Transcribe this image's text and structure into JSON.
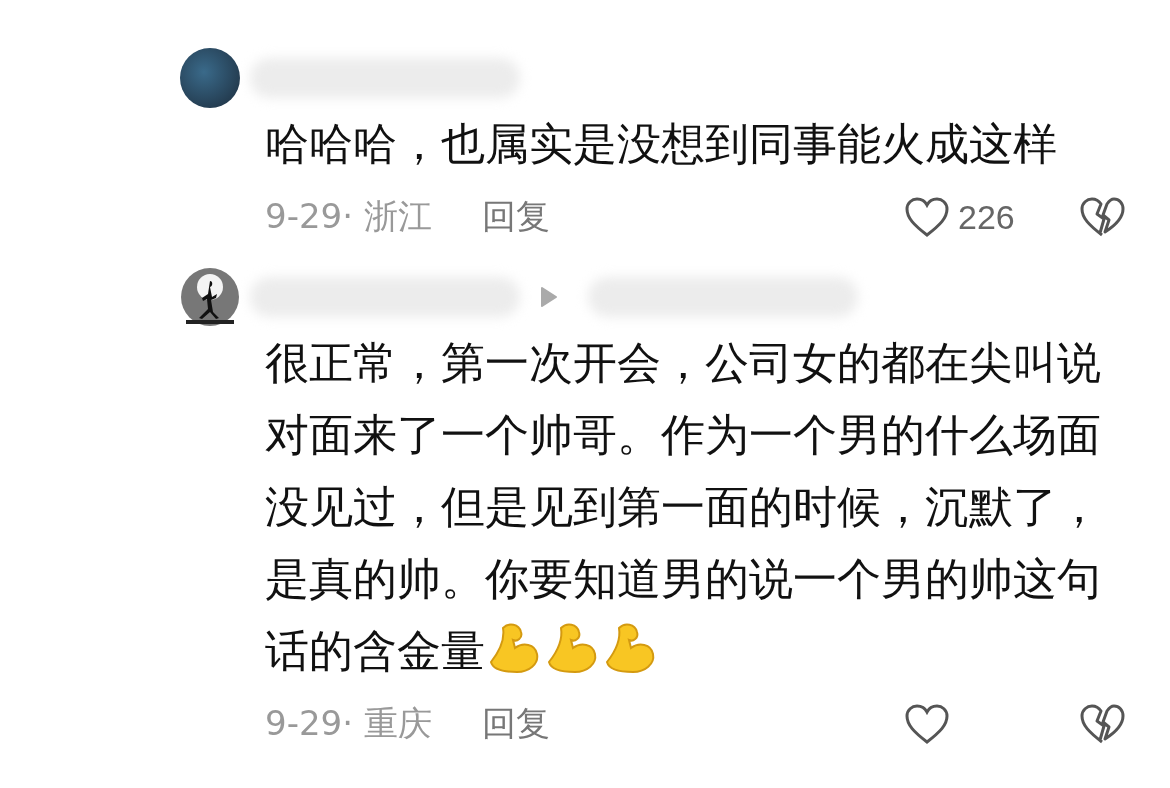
{
  "comments": [
    {
      "avatar": {
        "kind": "photo"
      },
      "is_reply": false,
      "text": "哈哈哈，也属实是没想到同事能火成这样",
      "date": "9-29·",
      "location": "浙江",
      "reply_label": "回复",
      "likes": "226"
    },
    {
      "avatar": {
        "kind": "silhouette"
      },
      "is_reply": true,
      "text": "很正常，第一次开会，公司女的都在尖叫说对面来了一个帅哥。作为一个男的什么场面没见过，但是见到第一面的时候，沉默了，是真的帅。你要知道男的说一个男的帅这句话的含金量",
      "emojis": [
        {
          "kind": "flexed-arm"
        },
        {
          "kind": "flexed-arm"
        },
        {
          "kind": "flexed-arm"
        }
      ],
      "date": "9-29·",
      "location": "重庆",
      "reply_label": "回复"
    }
  ]
}
